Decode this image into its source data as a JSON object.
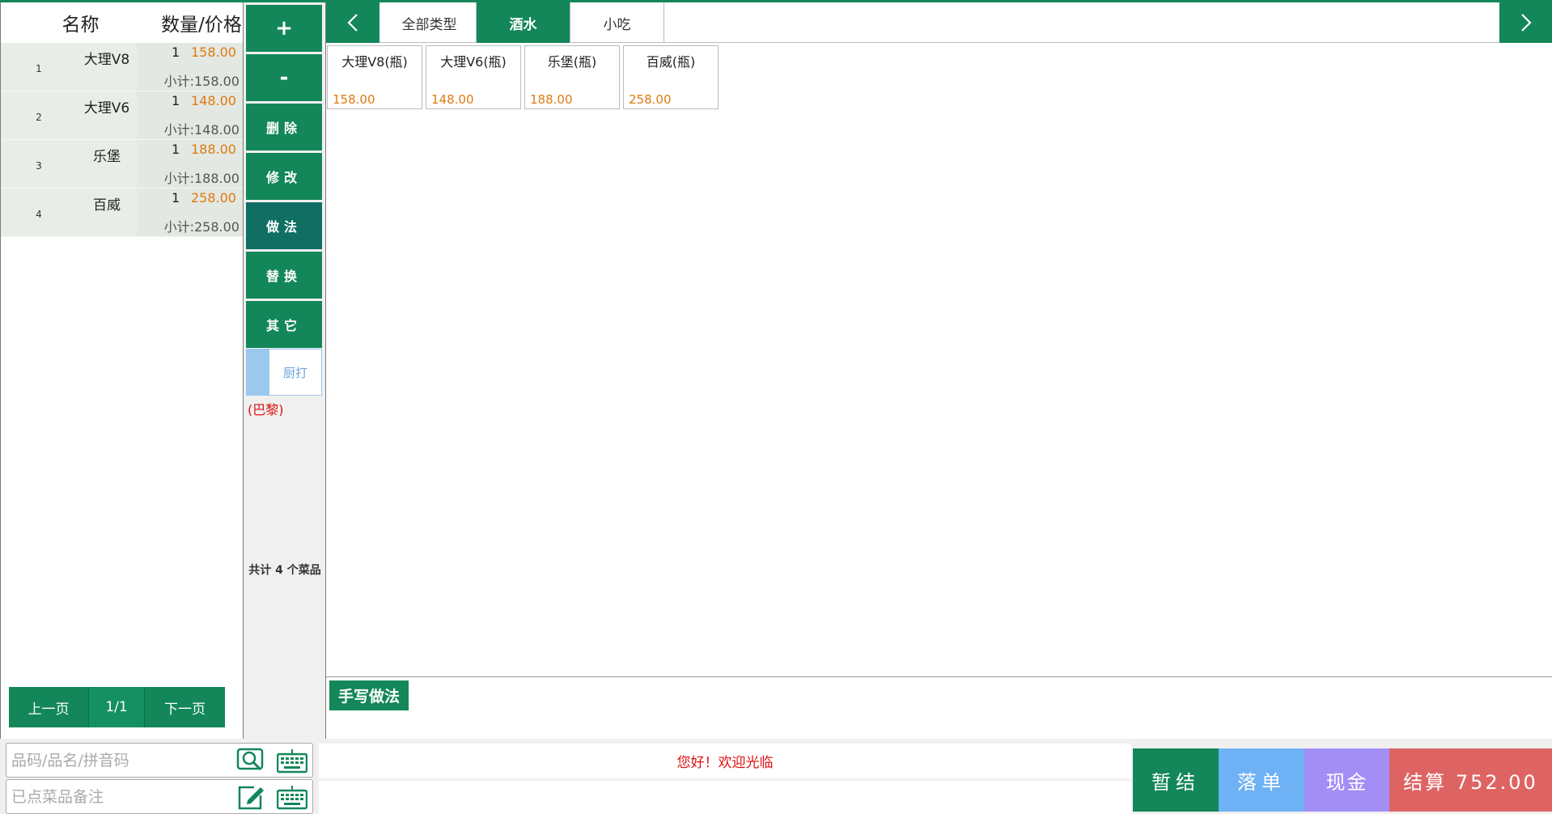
{
  "order": {
    "header_name": "名称",
    "header_qty": "数量/价格",
    "rows": [
      {
        "index": "1",
        "name": "大理V8",
        "qty": "1",
        "price": "158.00",
        "subtotal": "小计:158.00"
      },
      {
        "index": "2",
        "name": "大理V6",
        "qty": "1",
        "price": "148.00",
        "subtotal": "小计:148.00"
      },
      {
        "index": "3",
        "name": "乐堡",
        "qty": "1",
        "price": "188.00",
        "subtotal": "小计:188.00"
      },
      {
        "index": "4",
        "name": "百威",
        "qty": "1",
        "price": "258.00",
        "subtotal": "小计:258.00"
      }
    ],
    "pager": {
      "prev": "上一页",
      "page": "1/1",
      "next": "下一页"
    }
  },
  "actions": {
    "plus": "+",
    "minus": "-",
    "delete": "删除",
    "modify": "修改",
    "method": "做法",
    "replace": "替换",
    "other": "其它",
    "kitchen_print": "厨打",
    "location": "(巴黎)",
    "total_count": "共计 4 个菜品"
  },
  "tabs": [
    {
      "label": "全部类型",
      "active": false
    },
    {
      "label": "酒水",
      "active": true
    },
    {
      "label": "小吃",
      "active": false
    }
  ],
  "items": [
    {
      "name": "大理V8(瓶)",
      "price": "158.00"
    },
    {
      "name": "大理V6(瓶)",
      "price": "148.00"
    },
    {
      "name": "乐堡(瓶)",
      "price": "188.00"
    },
    {
      "name": "百威(瓶)",
      "price": "258.00"
    }
  ],
  "handwrite": {
    "title": "手写做法"
  },
  "bottom": {
    "search_placeholder": "品码/品名/拼音码",
    "note_placeholder": "已点菜品备注",
    "welcome": "您好！欢迎光临",
    "hold": "暂结",
    "place_order": "落单",
    "cash": "现金",
    "checkout": "结算 752.00"
  },
  "colors": {
    "primary": "#13875a",
    "price": "#e07a10",
    "alert": "#e01010",
    "place_order": "#6fb1f5",
    "cash": "#a38ef5",
    "checkout": "#de6464"
  },
  "icons": [
    "chevron-left-icon",
    "chevron-right-icon",
    "search-icon",
    "keyboard-icon",
    "edit-icon"
  ]
}
